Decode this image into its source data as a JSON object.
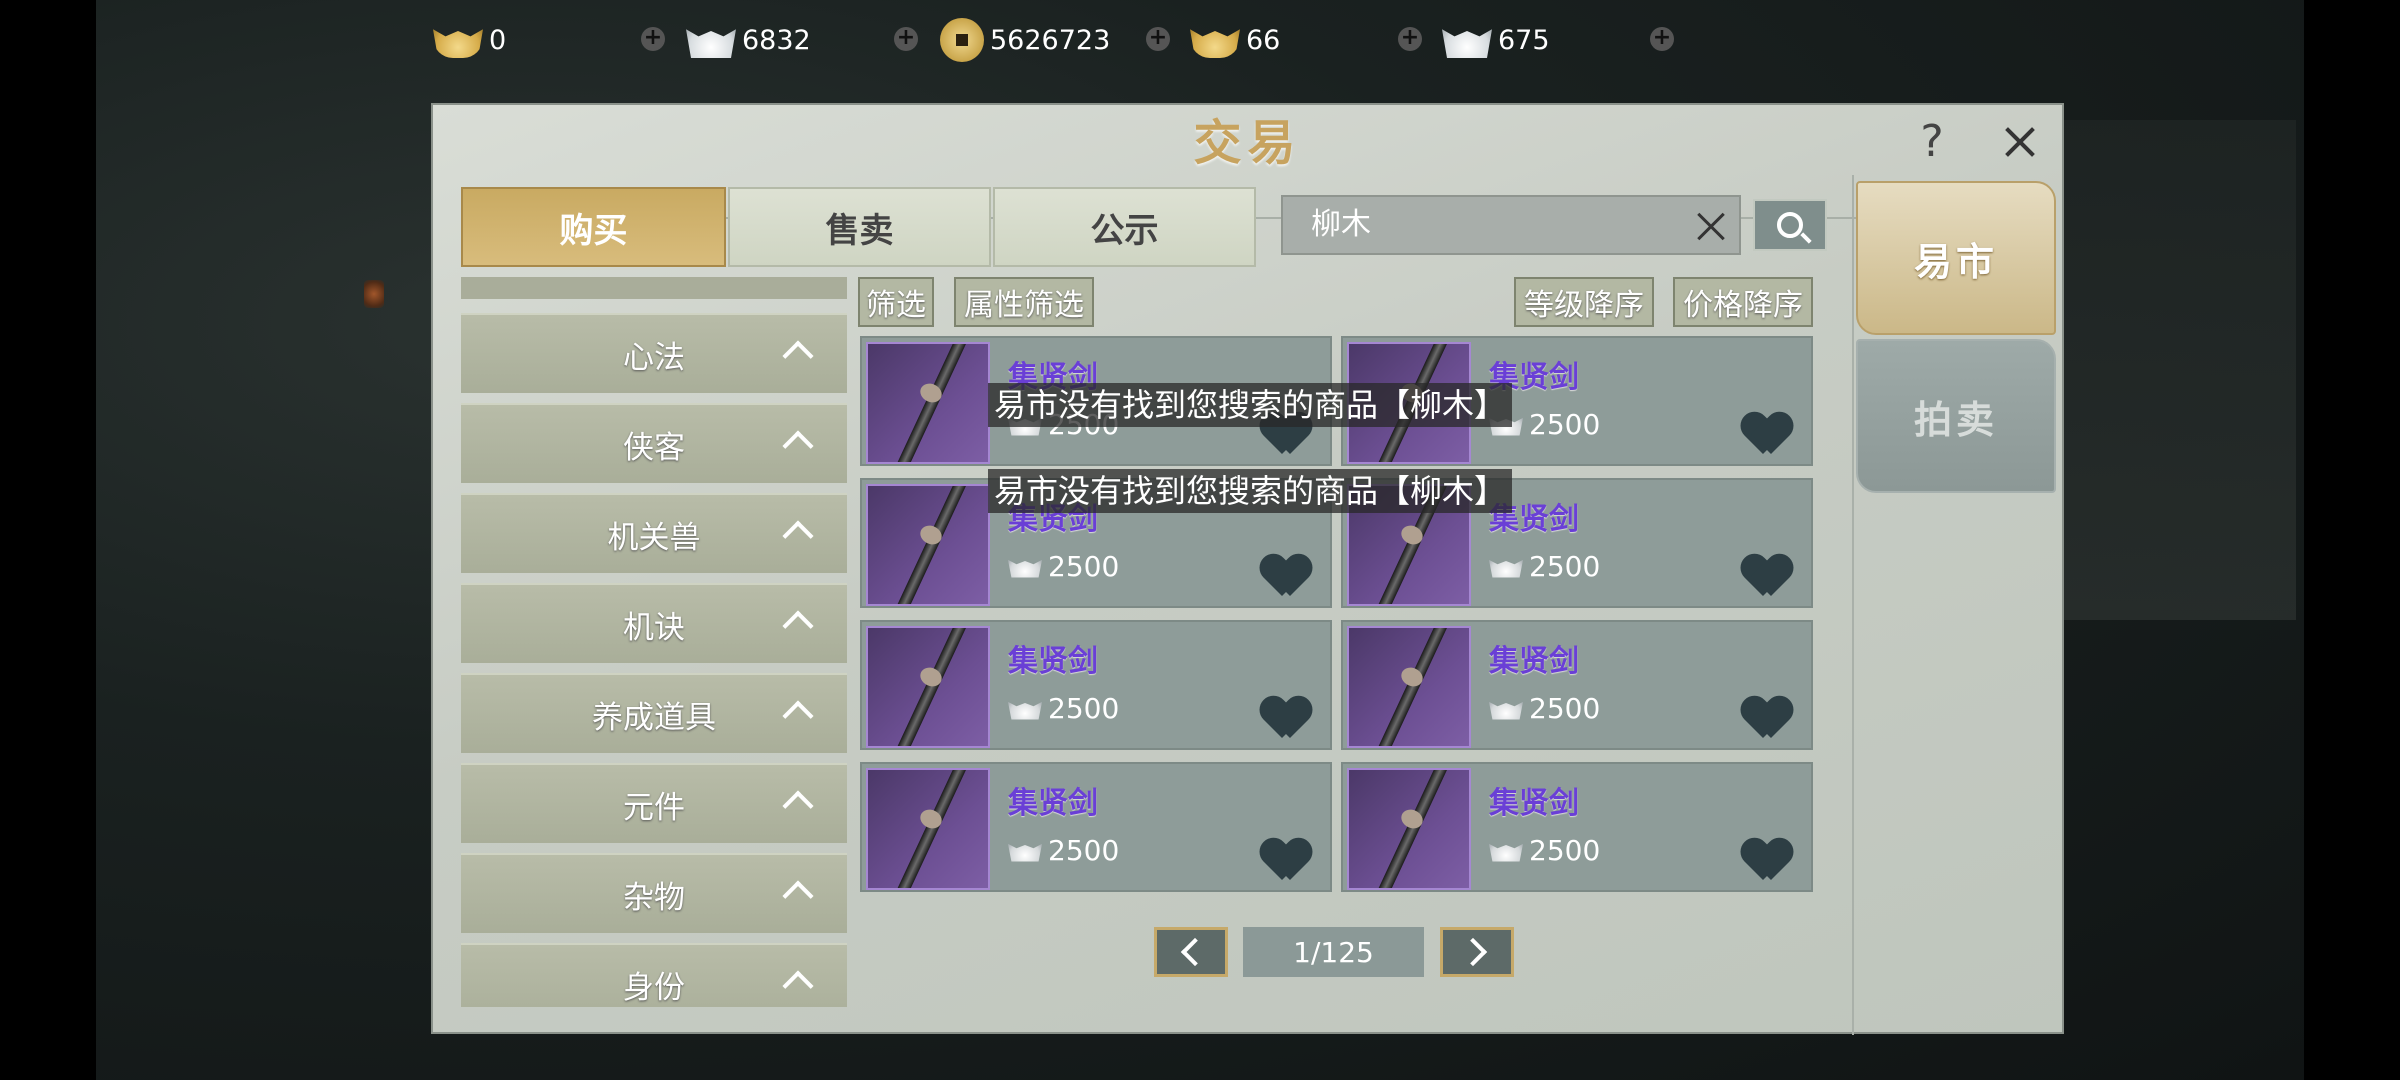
{
  "currencies": [
    {
      "icon": "gold-ingot-icon",
      "value": "0"
    },
    {
      "icon": "silver-ingot-icon",
      "value": "6832"
    },
    {
      "icon": "copper-coin-icon",
      "value": "5626723"
    },
    {
      "icon": "gold-ingot-alt-icon",
      "value": "66"
    },
    {
      "icon": "silver-ingot-alt-icon",
      "value": "675"
    }
  ],
  "panel": {
    "title": "交易",
    "help_label": "?"
  },
  "tabs": [
    "购买",
    "售卖",
    "公示"
  ],
  "search": {
    "value": "柳木"
  },
  "side_tabs": [
    "易市",
    "拍卖"
  ],
  "categories": [
    "心法",
    "侠客",
    "机关兽",
    "机诀",
    "养成道具",
    "元件",
    "杂物",
    "身份"
  ],
  "filters": {
    "filter": "筛选",
    "attr_filter": "属性筛选",
    "level_sort": "等级降序",
    "price_sort": "价格降序"
  },
  "items": [
    {
      "name": "集贤剑",
      "price": "2500"
    },
    {
      "name": "集贤剑",
      "price": "2500"
    },
    {
      "name": "集贤剑",
      "price": "2500"
    },
    {
      "name": "集贤剑",
      "price": "2500"
    },
    {
      "name": "集贤剑",
      "price": "2500"
    },
    {
      "name": "集贤剑",
      "price": "2500"
    },
    {
      "name": "集贤剑",
      "price": "2500"
    },
    {
      "name": "集贤剑",
      "price": "2500"
    }
  ],
  "toasts": [
    "易市没有找到您搜索的商品【柳木】",
    "易市没有找到您搜索的商品【柳木】"
  ],
  "pagination": {
    "label": "1/125"
  },
  "colors": {
    "accent_gold": "#c9aa62",
    "item_name": "#6a3fd6"
  }
}
